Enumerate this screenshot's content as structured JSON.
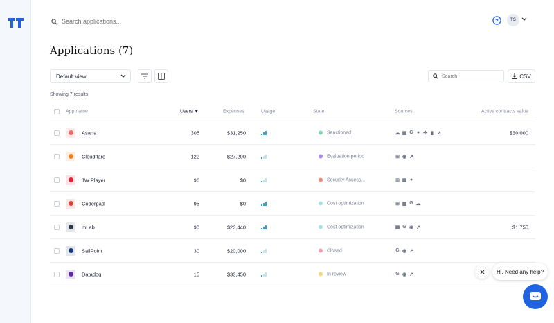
{
  "top": {
    "search_placeholder": "Search applications...",
    "avatar_initials": "TS"
  },
  "page": {
    "title": "Applications (7)",
    "view_select": "Default view",
    "table_search_placeholder": "Search",
    "csv_label": "CSV",
    "results": "Showing 7 results"
  },
  "table": {
    "headers": {
      "app_name": "App name",
      "users": "Users",
      "users_sort": "▼",
      "expenses": "Expenses",
      "usage": "Usage",
      "state": "State",
      "sources": "Sources",
      "contracts": "Active contracts value"
    },
    "rows": [
      {
        "name": "Asana",
        "users": "305",
        "expenses": "$31,250",
        "usage_level": 3,
        "state": "Sanctioned",
        "state_color": "#7fd6b4",
        "sources": [
          "cloud-icon",
          "grid-icon",
          "google-icon",
          "github-icon",
          "slack-icon",
          "doc-icon",
          "expense-icon"
        ],
        "contract": "$30,000",
        "logo_color": "#f06a6a"
      },
      {
        "name": "Cloudflare",
        "users": "122",
        "expenses": "$27,200",
        "usage_level": 1,
        "state": "Evaluation period",
        "state_color": "#a88be8",
        "sources": [
          "windows-icon",
          "okta-icon",
          "expense-icon"
        ],
        "contract": "",
        "logo_color": "#f38020"
      },
      {
        "name": "JW Player",
        "users": "96",
        "expenses": "$0",
        "usage_level": 1,
        "state": "Security Assess...",
        "state_color": "#ef8c7a",
        "sources": [
          "windows-icon",
          "grid-icon",
          "github-icon"
        ],
        "contract": "",
        "logo_color": "#e8233a"
      },
      {
        "name": "Coderpad",
        "users": "95",
        "expenses": "$0",
        "usage_level": 3,
        "state": "Cost optimization",
        "state_color": "#a5e3ea",
        "sources": [
          "windows-icon",
          "grid-icon",
          "google-icon",
          "cloud-icon"
        ],
        "contract": "",
        "logo_color": "#d9443a"
      },
      {
        "name": "mLab",
        "users": "90",
        "expenses": "$23,440",
        "usage_level": 3,
        "state": "Cost optimization",
        "state_color": "#a5e3ea",
        "sources": [
          "grid-icon",
          "google-icon",
          "okta-icon",
          "expense-icon"
        ],
        "contract": "$1,755",
        "logo_color": "#2d3a4a"
      },
      {
        "name": "SailPoint",
        "users": "30",
        "expenses": "$20,000",
        "usage_level": 1,
        "state": "Closed",
        "state_color": "#f2a0ae",
        "sources": [
          "google-icon",
          "okta-icon",
          "expense-icon"
        ],
        "contract": "",
        "logo_color": "#1b3a7a"
      },
      {
        "name": "Datadog",
        "users": "15",
        "expenses": "$33,450",
        "usage_level": 1,
        "state": "In review",
        "state_color": "#f6d77a",
        "sources": [
          "google-icon",
          "okta-icon",
          "expense-icon"
        ],
        "contract": "",
        "logo_color": "#632ca6"
      }
    ]
  },
  "chat": {
    "bubble": "Hi. Need any help?"
  },
  "colors": {
    "accent": "#1f63e0",
    "usage_bar": "#2fa7e0"
  }
}
